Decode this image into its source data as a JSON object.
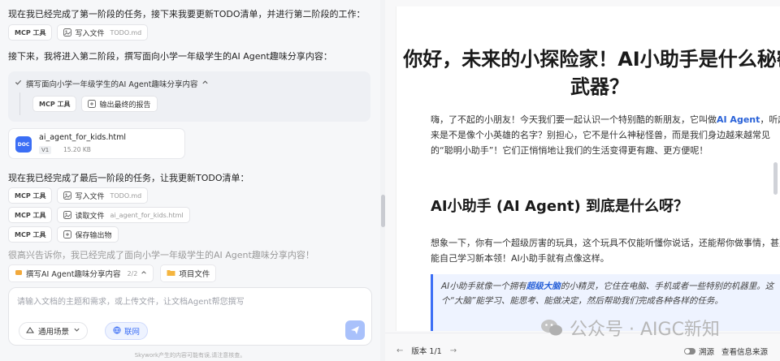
{
  "chat": {
    "msg1": "现在我已经完成了第一阶段的任务，接下来我要更新TODO清单，并进行第二阶段的工作：",
    "row1": {
      "tool": "MCP 工具",
      "action": "写入文件",
      "target": "TODO.md"
    },
    "msg2": "接下来，我将进入第二阶段，撰写面向小学一年级学生的AI Agent趣味分享内容：",
    "phase_card": {
      "title": "撰写面向小学一年级学生的AI Agent趣味分享内容",
      "tool": "MCP 工具",
      "action": "输出最终的报告"
    },
    "file_card": {
      "badge": "DOC",
      "name": "ai_agent_for_kids.html",
      "version": "V1",
      "size": "15.20 KB"
    },
    "msg3": "现在我已经完成了最后一阶段的任务，让我更新TODO清单：",
    "row2": {
      "tool": "MCP 工具",
      "action": "写入文件",
      "target": "TODO.md"
    },
    "row3": {
      "tool": "MCP 工具",
      "action": "读取文件",
      "target": "ai_agent_for_kids.html"
    },
    "row4": {
      "tool": "MCP 工具",
      "action": "保存输出物"
    },
    "msg_cut": "很高兴告诉你，我已经完成了面向小学一年级学生的AI Agent趣味分享内容！",
    "task_bar": {
      "task": "撰写AI Agent趣味分享内容",
      "count": "2/2",
      "files": "项目文件"
    },
    "input": {
      "placeholder": "请输入文档的主题和需求，或上传文件，让文档Agent帮您撰写",
      "value": ""
    },
    "scene_label": "通用场景",
    "net_label": "联网",
    "disclaimer": "Skywork产生的内容可能有误,请注意核查。"
  },
  "doc": {
    "title": "你好，未来的小探险家！AI小助手是什么秘密武器？",
    "p1_a": "嗨，了不起的小朋友！今天我们要一起认识一个特别酷的新朋友，它叫做",
    "p1_hl": "AI Agent",
    "p1_b": "，听起来是不是像个小英雄的名字？别担心，它不是什么神秘怪兽，而是我们身边越来越常见的“聪明小助手”！它们正悄悄地让我们的生活变得更有趣、更方便呢！",
    "h2": "AI小助手 (AI Agent) 到底是什么呀？",
    "p2": "想象一下，你有一个超级厉害的玩具，这个玩具不仅能听懂你说话，还能帮你做事情，甚至能自己学习新本领！AI小助手就有点像这样。",
    "quote_a": "AI小助手就像一个拥有",
    "quote_hl": "超级大脑",
    "quote_b": "的小精灵，它住在电脑、手机或者一些特别的机器里。这个“大脑”能学习、能思考、能做决定，然后帮助我们完成各种各样的任务。",
    "footer": {
      "version": "版本 1/1",
      "source": "溯源",
      "view_source": "查看信息来源"
    }
  },
  "watermark": "公众号 · AIGC新知",
  "colors": {
    "accent": "#3b6ef5",
    "highlight": "#2a62d8",
    "quote_bg": "#eef3ff"
  }
}
